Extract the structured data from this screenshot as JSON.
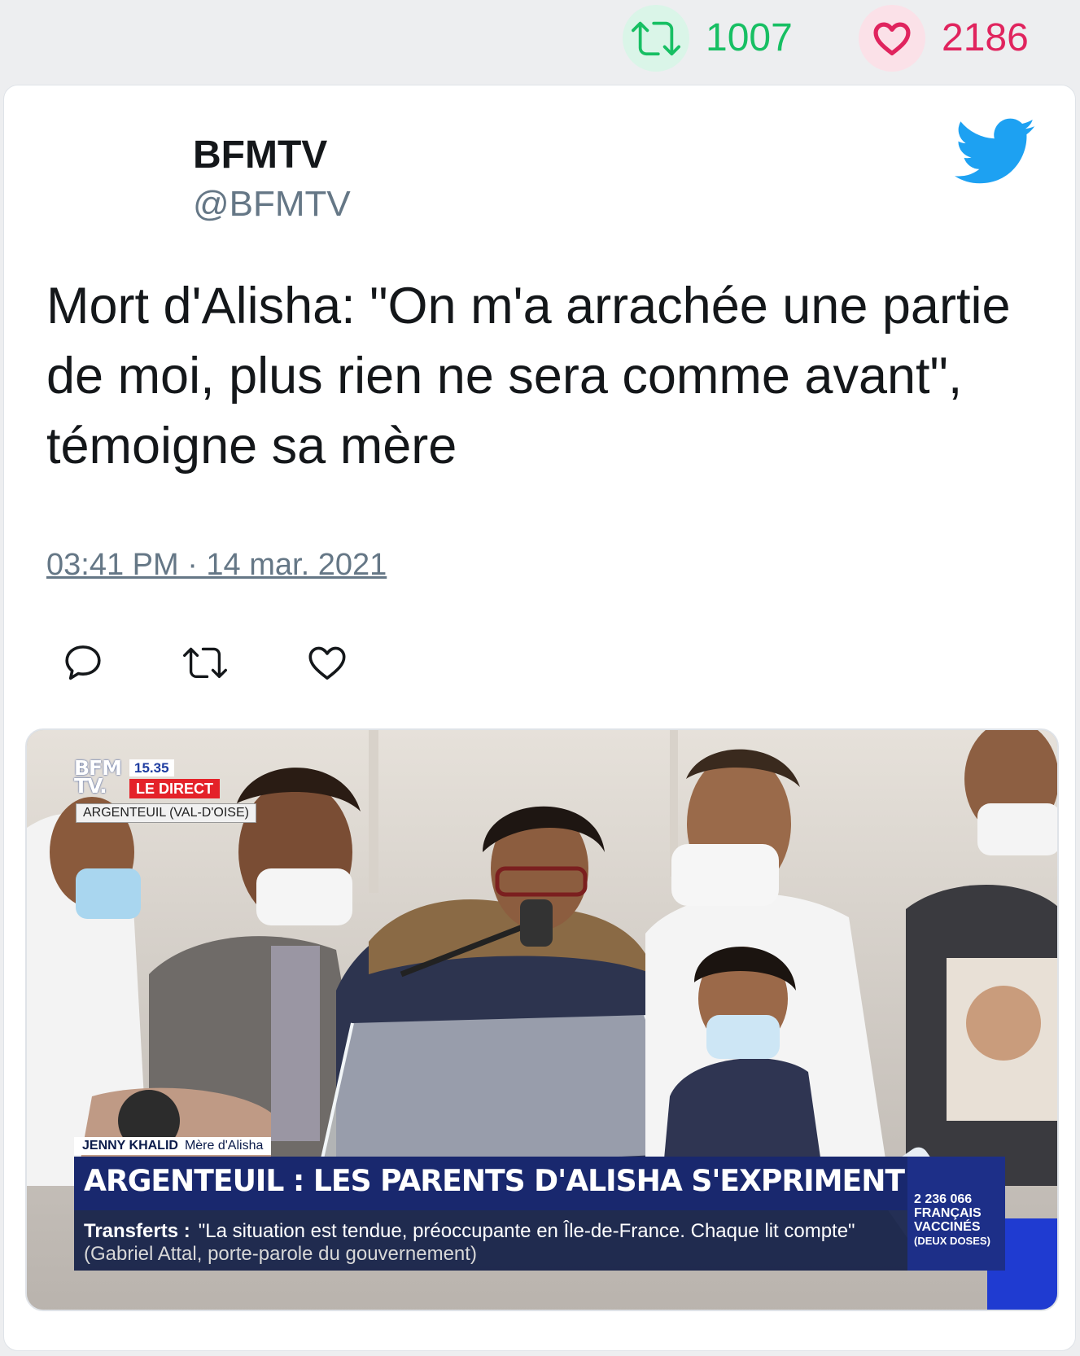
{
  "stats": {
    "retweets": "1007",
    "likes": "2186",
    "retweet_color": "#17bf63",
    "like_color": "#e0245e"
  },
  "tweet": {
    "author_name": "BFMTV",
    "author_handle": "@BFMTV",
    "brand_icon": "twitter-bird-icon",
    "brand_color": "#1da1f2",
    "text": "Mort d'Alisha: \"On m'a arrachée une partie de moi, plus rien ne sera comme avant\", témoigne sa mère",
    "timestamp": "03:41 PM · 14 mar. 2021",
    "actions": [
      {
        "name": "reply",
        "icon": "reply-icon"
      },
      {
        "name": "retweet",
        "icon": "retweet-icon"
      },
      {
        "name": "like",
        "icon": "like-icon"
      }
    ]
  },
  "media": {
    "logo": "BFM TV.",
    "time": "15.35",
    "live_label": "LE DIRECT",
    "location": "ARGENTEUIL (VAL-D'OISE)",
    "speaker_name": "JENNY KHALID",
    "speaker_role": "Mère d'Alisha",
    "headline": "ARGENTEUIL : LES PARENTS D'ALISHA S'EXPRIMENT",
    "ticker_label": "Transferts :",
    "ticker_quote": "\"La situation est tendue, préoccupante en Île-de-France. Chaque lit compte\"",
    "ticker_source": "(Gabriel Attal, porte-parole du gouvernement)",
    "counter_value": "2 236 066",
    "counter_line1": "FRANÇAIS",
    "counter_line2": "VACCINÉS",
    "counter_line3": "(DEUX DOSES)"
  }
}
